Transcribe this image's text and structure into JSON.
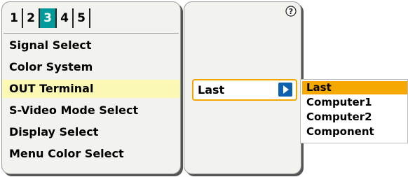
{
  "tabs": [
    {
      "label": "1",
      "active": false
    },
    {
      "label": "2",
      "active": false
    },
    {
      "label": "3",
      "active": true
    },
    {
      "label": "4",
      "active": false
    },
    {
      "label": "5",
      "active": false
    }
  ],
  "menu": {
    "items": [
      {
        "label": "Signal Select"
      },
      {
        "label": "Color System"
      },
      {
        "label": "OUT Terminal",
        "highlighted": true
      },
      {
        "label": "S-Video Mode Select"
      },
      {
        "label": "Display Select"
      },
      {
        "label": "Menu Color Select"
      }
    ]
  },
  "help": {
    "icon": "help-icon"
  },
  "out_terminal": {
    "value": "Last",
    "arrow_icon": "triangle-right-icon",
    "options": [
      "Last",
      "Computer1",
      "Computer2",
      "Component"
    ],
    "selected": "Last"
  },
  "colors": {
    "active_tab": "#009a9a",
    "highlight_row": "#fbf8b4",
    "select_border": "#f0a800",
    "selected_option": "#f5a800",
    "arrow_button": "#1060b0",
    "panel": "#f2f2ee"
  }
}
